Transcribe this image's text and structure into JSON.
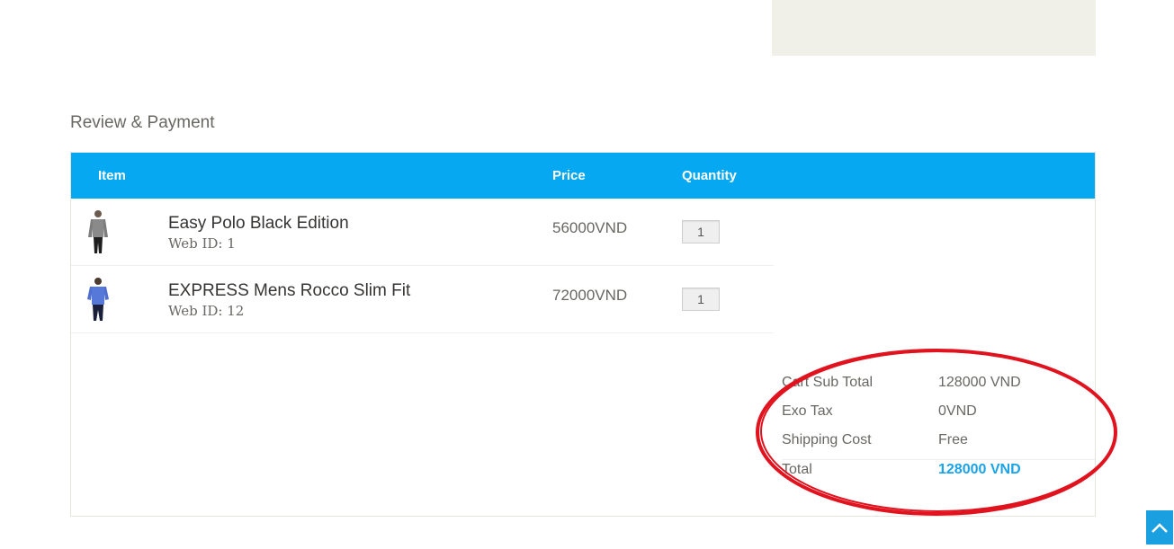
{
  "section": {
    "title": "Review & Payment"
  },
  "cart": {
    "headers": {
      "item": "Item",
      "price": "Price",
      "quantity": "Quantity"
    },
    "items": [
      {
        "name": "Easy Polo Black Edition",
        "web_id": "Web ID: 1",
        "price": "56000VND",
        "quantity": "1",
        "thumb_icon": "shirt-gray-model-icon"
      },
      {
        "name": "EXPRESS Mens Rocco Slim Fit",
        "web_id": "Web ID: 12",
        "price": "72000VND",
        "quantity": "1",
        "thumb_icon": "shirt-blue-model-icon"
      }
    ]
  },
  "totals": {
    "subtotal_label": "Cart Sub Total",
    "subtotal_value": "128000 VND",
    "tax_label": "Exo Tax",
    "tax_value": "0VND",
    "shipping_label": "Shipping Cost",
    "shipping_value": "Free",
    "total_label": "Total",
    "total_value": "128000 VND"
  },
  "colors": {
    "header": "#06a8f2",
    "total_value": "#1aa3e6",
    "annotation": "#e0131f",
    "scroll_button": "#1a9fe0"
  }
}
